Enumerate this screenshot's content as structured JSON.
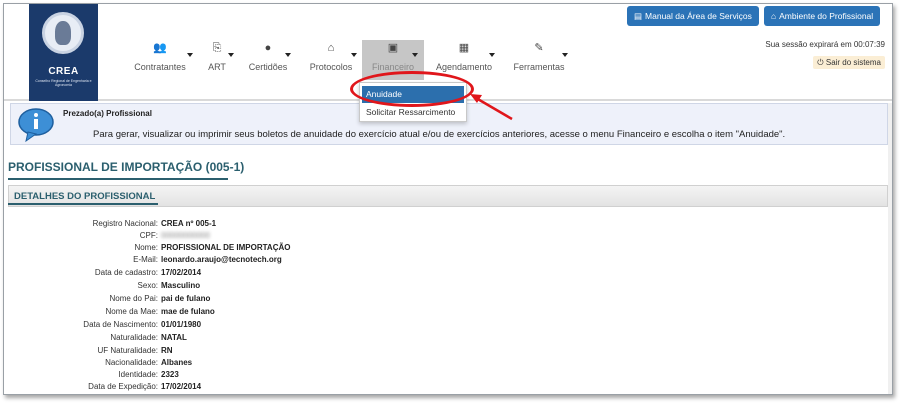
{
  "brand": {
    "name": "CREA",
    "subtitle": "Conselho Regional de Engenharia e Agronomia"
  },
  "top_buttons": {
    "manual": "Manual da Área de Serviços",
    "ambiente": "Ambiente do Profissional"
  },
  "session": {
    "text": "Sua sessão expirará em 00:07:39",
    "logout": "Sair do sistema"
  },
  "menu": [
    {
      "label": "Contratantes",
      "icon": "users-icon",
      "glyph": "👥"
    },
    {
      "label": "ART",
      "icon": "copy-icon",
      "glyph": "⎘"
    },
    {
      "label": "Certidões",
      "icon": "circle-icon",
      "glyph": "●"
    },
    {
      "label": "Protocolos",
      "icon": "inbox-icon",
      "glyph": "⌂"
    },
    {
      "label": "Financeiro",
      "icon": "money-icon",
      "glyph": "▣"
    },
    {
      "label": "Agendamento",
      "icon": "calendar-icon",
      "glyph": "▦"
    },
    {
      "label": "Ferramentas",
      "icon": "wrench-icon",
      "glyph": "✎"
    }
  ],
  "dropdown": {
    "items": [
      "Anuidade",
      "Solicitar Ressarcimento"
    ]
  },
  "info": {
    "title": "Prezado(a) Profissional",
    "message": "Para gerar, visualizar ou imprimir seus boletos de anuidade do exercício atual e/ou de exercícios anteriores, acesse o menu Financeiro e escolha o item \"Anuidade\"."
  },
  "page_title": "PROFISSIONAL DE IMPORTAÇÃO (005-1)",
  "section_title": "DETALHES DO PROFISSIONAL",
  "details": [
    {
      "label": "Registro Nacional:",
      "value": "CREA nº 005-1"
    },
    {
      "label": "CPF:",
      "value": "00000000000"
    },
    {
      "label": "Nome:",
      "value": "PROFISSIONAL DE IMPORTAÇÃO"
    },
    {
      "label": "E-Mail:",
      "value": "leonardo.araujo@tecnotech.org"
    },
    {
      "label": "Data de cadastro:",
      "value": "17/02/2014"
    },
    {
      "label": "Sexo:",
      "value": "Masculino"
    },
    {
      "label": "Nome do Pai:",
      "value": "pai de fulano"
    },
    {
      "label": "Nome da Mae:",
      "value": "mae de fulano"
    },
    {
      "label": "Data de Nascimento:",
      "value": "01/01/1980"
    },
    {
      "label": "Naturalidade:",
      "value": "NATAL"
    },
    {
      "label": "UF Naturalidade:",
      "value": "RN"
    },
    {
      "label": "Nacionalidade:",
      "value": "Albanes"
    },
    {
      "label": "Identidade:",
      "value": "2323"
    },
    {
      "label": "Data de Expedição:",
      "value": "17/02/2014"
    }
  ],
  "colors": {
    "primary": "#2b73b7",
    "brand_navy": "#1b3a6b",
    "highlight_ring": "#e0161b",
    "title_teal": "#2b5f6e"
  }
}
